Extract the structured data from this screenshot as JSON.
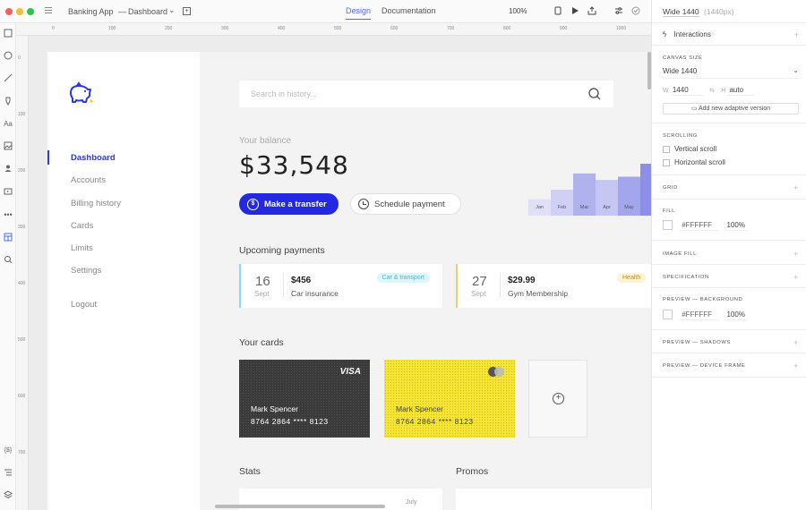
{
  "titlebar": {
    "project": "Banking App",
    "separator": "—",
    "screen": "Dashboard",
    "chevron": "⌄",
    "tabs": [
      "Design",
      "Documentation"
    ],
    "zoom": "100%"
  },
  "ruler": {
    "top": [
      "0",
      "100",
      "200",
      "300",
      "400",
      "500",
      "600",
      "700",
      "800",
      "900",
      "1000"
    ],
    "left": [
      "0",
      "100",
      "200",
      "300",
      "400",
      "500",
      "600",
      "700"
    ]
  },
  "sidebar": {
    "items": [
      {
        "label": "Dashboard",
        "active": true
      },
      {
        "label": "Accounts"
      },
      {
        "label": "Billing history"
      },
      {
        "label": "Cards"
      },
      {
        "label": "Limits"
      },
      {
        "label": "Settings"
      }
    ],
    "logout": "Logout"
  },
  "search": {
    "placeholder": "Search in history..."
  },
  "balance": {
    "label": "Your balance",
    "amount": "$33,548"
  },
  "actions": {
    "transfer": "Make a transfer",
    "schedule": "Schedule payment"
  },
  "chart_data": {
    "type": "bar",
    "categories": [
      "Jan",
      "Feb",
      "Mar",
      "Apr",
      "May",
      ""
    ],
    "values": [
      5,
      8,
      13,
      11,
      12,
      16
    ],
    "colors": [
      "#dfe0f7",
      "#cfd0f4",
      "#b0b2ee",
      "#c5c6f2",
      "#a4a6ec",
      "#8c8fe8"
    ]
  },
  "upcoming": {
    "title": "Upcoming payments",
    "items": [
      {
        "day": "16",
        "month": "Sept",
        "amount": "$456",
        "name": "Car insurance",
        "tag": "Car & transport",
        "accent": "#7fe0ea",
        "tag_bg": "#dcf7fa",
        "tag_fg": "#4ab9c6"
      },
      {
        "day": "27",
        "month": "Sept",
        "amount": "$29.99",
        "name": "Gym Membership",
        "tag": "Health",
        "accent": "#f2cd6a",
        "tag_bg": "#fbf3d4",
        "tag_fg": "#b0902a"
      }
    ]
  },
  "cards": {
    "title": "Your cards",
    "items": [
      {
        "holder": "Mark Spencer",
        "number": "8764  2864  ****  8123",
        "brand": "VISA"
      },
      {
        "holder": "Mark Spencer",
        "number": "8764  2864  ****  8123",
        "brand": ""
      }
    ],
    "add": "+"
  },
  "bottom": {
    "stats": "Stats",
    "promos": "Promos",
    "partial": "July"
  },
  "inspector": {
    "preset": "Wide 1440",
    "preset_px": "(1440px)",
    "interactions": "Interactions",
    "canvas_size": "CANVAS SIZE",
    "canvas_preset": "Wide 1440",
    "w_label": "W",
    "w_value": "1440",
    "h_label": "H",
    "h_value": "auto",
    "adaptive": "Add new adaptive version",
    "scrolling": "SCROLLING",
    "vscroll": "Vertical scroll",
    "hscroll": "Horizontal scroll",
    "grid": "GRID",
    "fill": "FILL",
    "fill_hex": "#FFFFFF",
    "fill_opacity": "100%",
    "image_fill": "IMAGE FILL",
    "specification": "SPECIFICATION",
    "preview_bg": "PREVIEW — BACKGROUND",
    "bg_hex": "#FFFFFF",
    "bg_opacity": "100%",
    "preview_shadows": "PREVIEW — SHADOWS",
    "preview_device": "PREVIEW — DEVICE FRAME"
  },
  "colors": {
    "primary": "#2428e0",
    "accent_blue": "#4a6cf7",
    "card_yellow": "#f6e532",
    "card_dark": "#3a3a3a"
  }
}
